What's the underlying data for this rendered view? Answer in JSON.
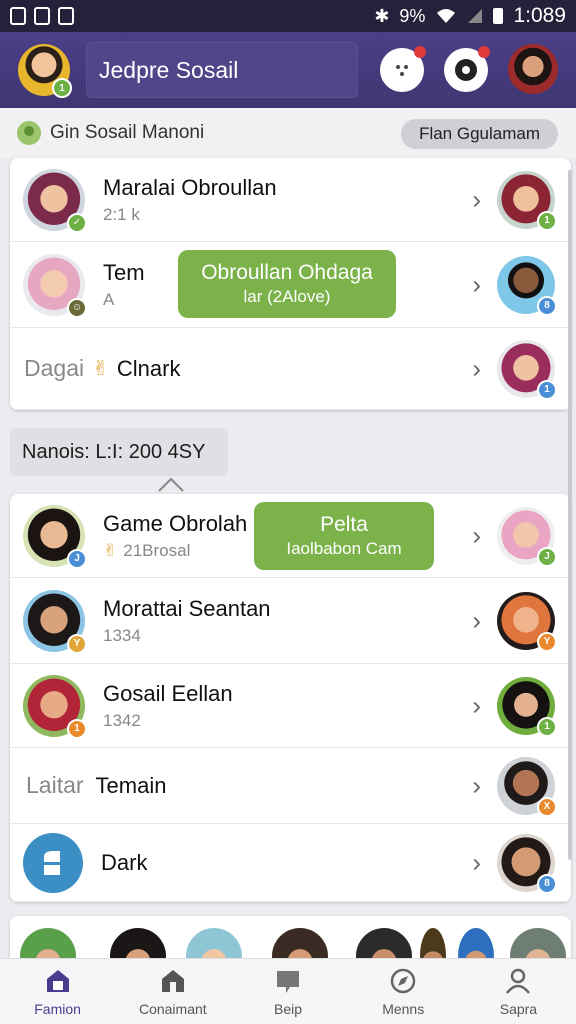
{
  "status_bar": {
    "battery": "9%",
    "time": "1:089"
  },
  "header": {
    "search_text": "Jedpre Sosail",
    "avatar_badge": "1"
  },
  "subheader": {
    "title": "Gin Sosail Manoni",
    "pill": "Flan Ggulamam"
  },
  "card1": {
    "rows": [
      {
        "title": "Maralai Obroullan",
        "subtitle": "2:1 k",
        "badge": "1"
      },
      {
        "title": "Tem",
        "subtitle": "A",
        "badge": "8"
      },
      {
        "label": "Dagai",
        "title": "Clnark",
        "badge": "1"
      }
    ],
    "tooltip": {
      "title": "Obroullan Ohdaga",
      "subtitle": "lar (2Alove)"
    }
  },
  "section": {
    "label": "Nanois: L:I: 200 4SY"
  },
  "card2": {
    "rows": [
      {
        "title": "Game Obrolah",
        "subtitle": "21Brosal",
        "badge": "J"
      },
      {
        "title": "Morattai Seantan",
        "subtitle": "1334",
        "badge": "Y"
      },
      {
        "title": "Gosail Eellan",
        "subtitle": "1342",
        "badge": "1"
      },
      {
        "label": "Laitar",
        "title": "Temain",
        "badge": "X"
      },
      {
        "title": "Dark",
        "badge": "8"
      }
    ],
    "tooltip": {
      "title": "Pelta",
      "subtitle": "Iaolbabon Cam"
    }
  },
  "bottom_nav": {
    "items": [
      {
        "label": "Famion",
        "icon": "home-icon"
      },
      {
        "label": "Conaimant",
        "icon": "house-icon"
      },
      {
        "label": "Beip",
        "icon": "chat-icon"
      },
      {
        "label": "Menns",
        "icon": "compass-icon"
      },
      {
        "label": "Sapra",
        "icon": "person-icon"
      }
    ]
  },
  "colors": {
    "header": "#4b3f86",
    "accent_green": "#7bb24a",
    "active_nav": "#4a3b8f"
  }
}
